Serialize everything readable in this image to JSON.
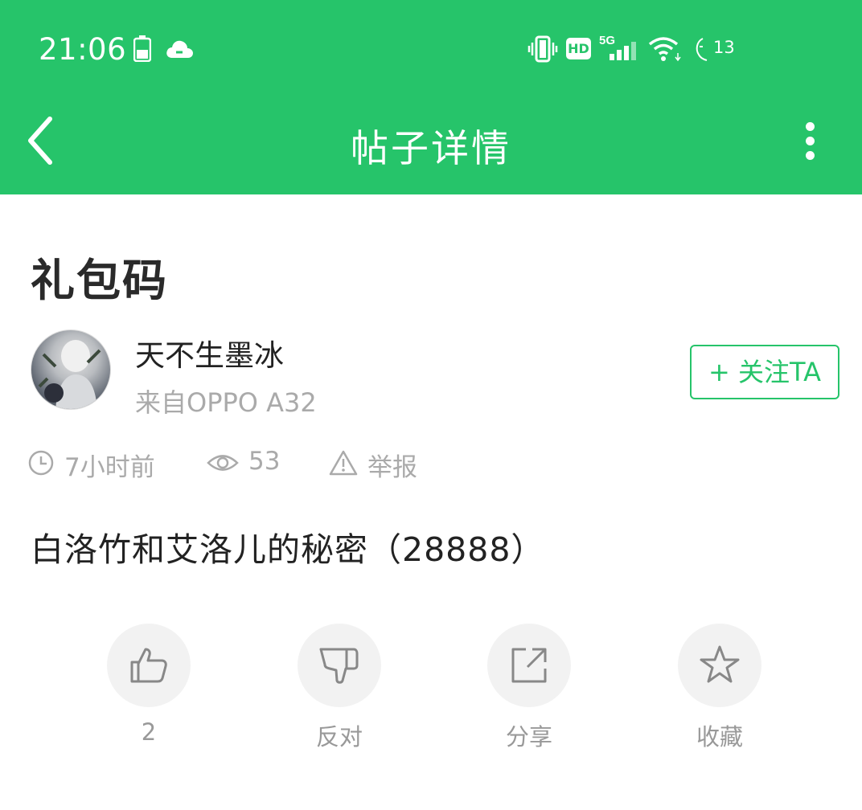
{
  "status_bar": {
    "time": "21:06",
    "hd_label": "HD",
    "network_label": "5G",
    "battery_level": "13",
    "icons": [
      "battery-icon",
      "cloud-icon",
      "vibrate-icon",
      "hd-icon",
      "signal-icon",
      "wifi-icon",
      "moon-icon"
    ]
  },
  "nav": {
    "title": "帖子详情",
    "back_icon": "chevron-left-icon",
    "more_icon": "more-vertical-icon"
  },
  "post": {
    "title": "礼包码",
    "author": {
      "name": "天不生墨冰",
      "device": "来自OPPO A32"
    },
    "follow_label": "+ 关注TA",
    "meta": {
      "time": "7小时前",
      "views": "53",
      "report": "举报"
    },
    "body": "白洛竹和艾洛儿的秘密（28888）"
  },
  "actions": {
    "like": "2",
    "dislike": "反对",
    "share": "分享",
    "favorite": "收藏"
  },
  "colors": {
    "accent": "#26c46a",
    "muted_text": "#aaaaaa",
    "action_bg": "#f2f2f2"
  }
}
